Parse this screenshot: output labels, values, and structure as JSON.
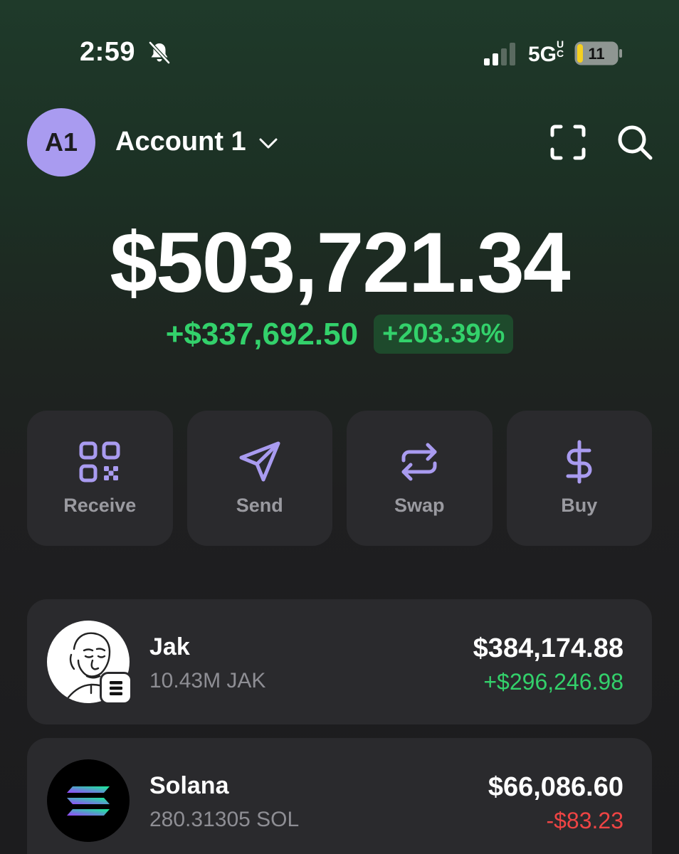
{
  "status_bar": {
    "time": "2:59",
    "network": "5G",
    "network_suffix": "UC",
    "battery": "11",
    "icons": [
      "bell-muted-icon",
      "cellular-signal-icon",
      "battery-icon"
    ]
  },
  "header": {
    "avatar_initials": "A1",
    "account_name": "Account 1",
    "icons": [
      "chevron-down-icon",
      "scan-icon",
      "search-icon"
    ]
  },
  "balance": {
    "total": "$503,721.34",
    "change_amount": "+$337,692.50",
    "change_percent": "+203.39%"
  },
  "actions": [
    {
      "label": "Receive",
      "icon": "qr-code-icon"
    },
    {
      "label": "Send",
      "icon": "send-icon"
    },
    {
      "label": "Swap",
      "icon": "swap-icon"
    },
    {
      "label": "Buy",
      "icon": "dollar-icon"
    }
  ],
  "tokens": [
    {
      "name": "Jak",
      "amount": "10.43M JAK",
      "value": "$384,174.88",
      "change": "+$296,246.98",
      "icon": "jak-wojak-logo"
    },
    {
      "name": "Solana",
      "amount": "280.31305 SOL",
      "value": "$66,086.60",
      "change": "-$83.23",
      "icon": "solana-logo"
    }
  ],
  "colors": {
    "accent": "#a99bf0",
    "positive": "#33d16b",
    "negative": "#ef4444",
    "card": "#2a2a2d"
  }
}
